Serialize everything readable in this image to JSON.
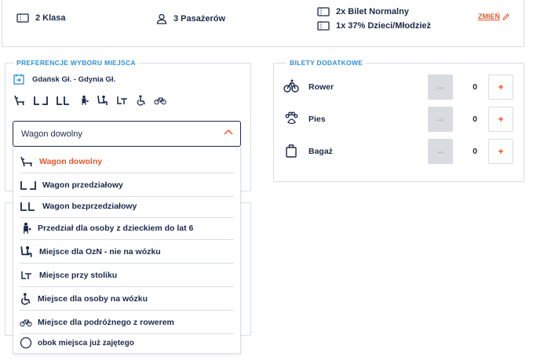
{
  "summary": {
    "class_label": "2 Klasa",
    "passengers_label": "3 Pasażerów",
    "tickets": [
      "2x Bilet Normalny",
      "1x 37% Dzieci/Młodzież"
    ],
    "change_label": "ZMIEŃ"
  },
  "preferences": {
    "legend": "PREFERENCJE WYBORU MIEJSCA",
    "route": "Gdańsk Gł. - Gdynia Gł.",
    "seat_icons": [
      "reclining-seat-icon",
      "compartment-seats-icon",
      "open-seats-icon",
      "child-compartment-icon",
      "disabled-seat-icon",
      "table-seat-icon",
      "wheelchair-icon",
      "bicycle-icon"
    ],
    "select_value": "Wagon dowolny",
    "options": [
      {
        "label": "Wagon dowolny",
        "icon": "reclining-seat-icon",
        "selected": true
      },
      {
        "label": "Wagon przedziałowy",
        "icon": "compartment-seats-icon"
      },
      {
        "label": "Wagon bezprzedziałowy",
        "icon": "open-seats-icon"
      },
      {
        "label": "Przedział dla osoby z dzieckiem do lat 6",
        "icon": "child-compartment-icon"
      },
      {
        "label": "Miejsce dla OzN - nie na wózku",
        "icon": "disabled-seat-icon"
      },
      {
        "label": "Miejsce przy stoliku",
        "icon": "table-seat-icon"
      },
      {
        "label": "Miejsce dla osoby na wózku",
        "icon": "wheelchair-icon"
      },
      {
        "label": "Miejsce dla podróżnego z rowerem",
        "icon": "bicycle-icon"
      },
      {
        "label": "obok miejsca już zajętego",
        "icon": "radio-circle-icon"
      }
    ]
  },
  "extras": {
    "legend": "BILETY DODATKOWE",
    "items": [
      {
        "label": "Rower",
        "qty": "0",
        "icon": "bicycle-icon"
      },
      {
        "label": "Pies",
        "qty": "0",
        "icon": "paw-icon"
      },
      {
        "label": "Bagaż",
        "qty": "0",
        "icon": "luggage-icon"
      }
    ],
    "minus": "–",
    "plus": "+"
  },
  "colors": {
    "navy": "#1b2a4a",
    "accent": "#e8572a",
    "legend_blue": "#2d8fd5",
    "border": "#d9dde3"
  }
}
